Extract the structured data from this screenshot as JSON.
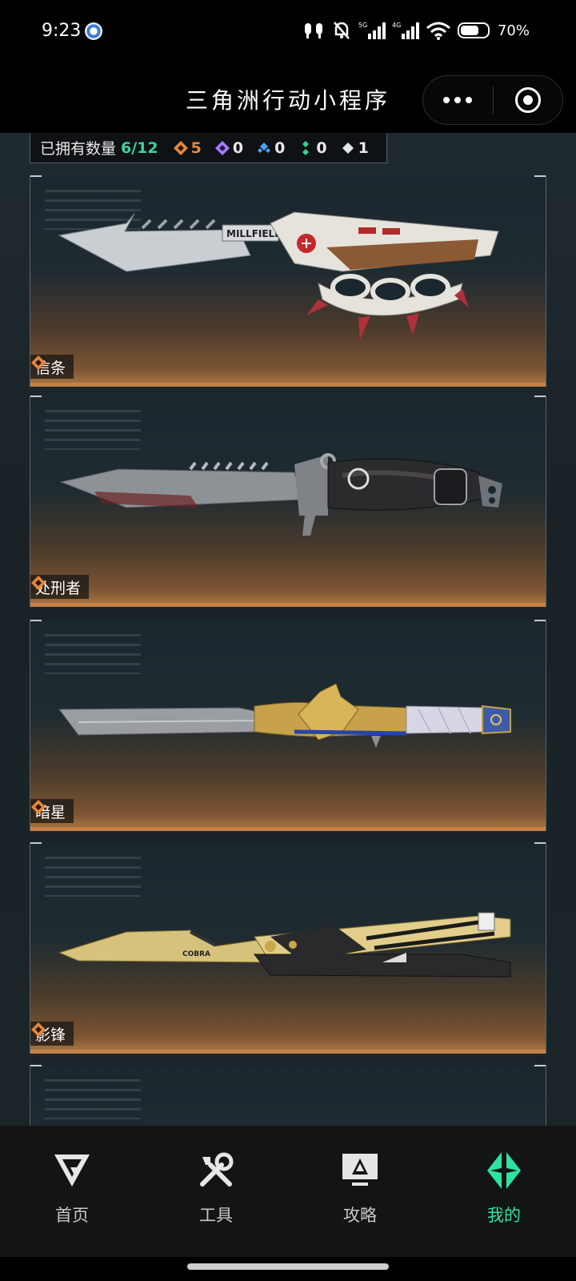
{
  "status_bar": {
    "time": "9:23",
    "battery": "70%"
  },
  "header": {
    "title": "三角洲行动小程序"
  },
  "stats": {
    "owned_label": "已拥有数量",
    "owned_count": "6/12",
    "items": [
      {
        "icon": "orange-diamond-icon",
        "color": "#e7873a",
        "value": "5"
      },
      {
        "icon": "purple-diamond-icon",
        "color": "#a77bff",
        "value": "0"
      },
      {
        "icon": "blue-diamond-icon",
        "color": "#4aa3ff",
        "value": "0"
      },
      {
        "icon": "green-diamond-icon",
        "color": "#34d48e",
        "value": "0"
      },
      {
        "icon": "white-diamond-icon",
        "color": "#e6e6e6",
        "value": "1"
      }
    ]
  },
  "knives": [
    {
      "name": "信条"
    },
    {
      "name": "处刑者"
    },
    {
      "name": "暗星"
    },
    {
      "name": "影锋"
    }
  ],
  "nav": {
    "items": [
      {
        "label": "首页"
      },
      {
        "label": "工具"
      },
      {
        "label": "攻略"
      },
      {
        "label": "我的"
      }
    ],
    "active_color": "#2fe3a0"
  }
}
